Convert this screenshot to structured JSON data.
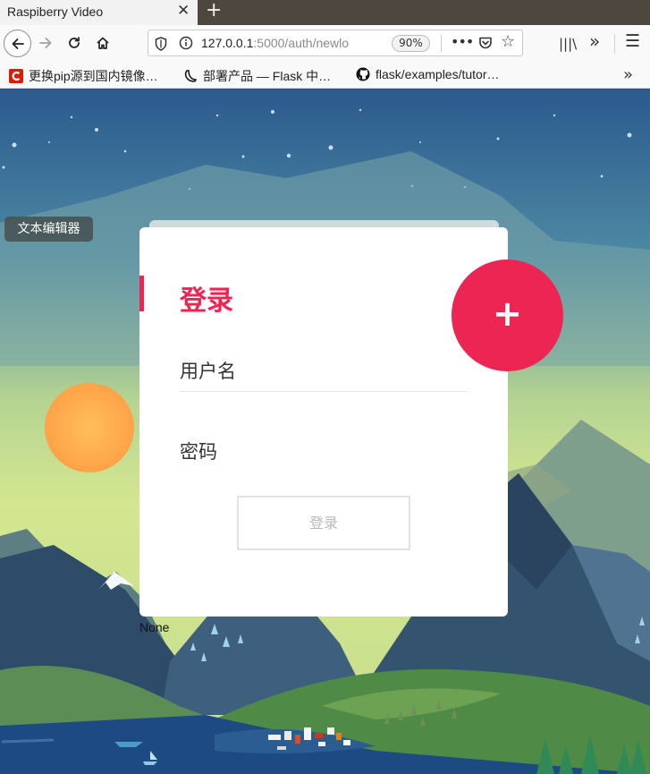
{
  "browser": {
    "tab_title": "Raspiberry Video",
    "tab_close": "✕",
    "new_tab": "+",
    "url_host": "127.0.0.1",
    "url_rest": ":5000/auth/newlo",
    "zoom": "90%",
    "more": "•••",
    "bookmarks": [
      {
        "label": "更换pip源到国内镜像…",
        "icon": "red-c-icon"
      },
      {
        "label": "部署产品 — Flask 中…",
        "icon": "flask-horn-icon"
      },
      {
        "label": "flask/examples/tutor…",
        "icon": "github-icon"
      }
    ]
  },
  "page": {
    "editor_button": "文本编辑器",
    "login_title": "登录",
    "username_label": "用户名",
    "password_label": "密码",
    "login_button": "登录",
    "fab_label": "+",
    "footer_text": "None"
  },
  "colors": {
    "accent": "#ed2553",
    "sky_top": "#2b5a8e",
    "sun": "#ffa84a"
  }
}
